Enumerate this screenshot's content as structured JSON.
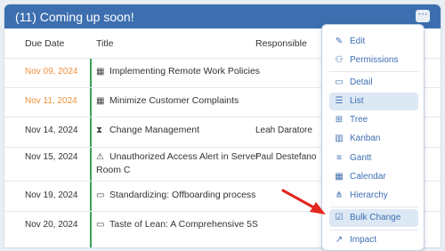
{
  "header": {
    "title": "(11) Coming up soon!",
    "menu_glyph": "⋯"
  },
  "columns": {
    "due": "Due Date",
    "title": "Title",
    "responsible": "Responsible"
  },
  "rows": [
    {
      "due": "Nov 09, 2024",
      "title": "Implementing Remote Work Policies",
      "responsible": "",
      "icon": "calendar-icon",
      "glyph": "▦",
      "overdue": true
    },
    {
      "due": "Nov 11, 2024",
      "title": "Minimize Customer Complaints",
      "responsible": "",
      "icon": "calendar-icon",
      "glyph": "▦",
      "overdue": true
    },
    {
      "due": "Nov 14, 2024",
      "title": "Change Management",
      "responsible": "Leah Daratore",
      "icon": "hourglass-icon",
      "glyph": "⧗",
      "overdue": false
    },
    {
      "due": "Nov 15, 2024",
      "title": "Unauthorized Access Alert in Server Room C",
      "responsible": "Paul Destefano",
      "icon": "warning-icon",
      "glyph": "⚠",
      "overdue": false
    },
    {
      "due": "Nov 19, 2024",
      "title": "Standardizing: Offboarding process",
      "responsible": "",
      "icon": "folder-icon",
      "glyph": "▭",
      "overdue": false
    },
    {
      "due": "Nov 20, 2024",
      "title": "Taste of Lean: A Comprehensive 5S",
      "responsible": "",
      "icon": "folder-icon",
      "glyph": "▭",
      "overdue": false
    }
  ],
  "menu": {
    "edit": {
      "label": "Edit",
      "glyph": "✎"
    },
    "permissions": {
      "label": "Permissions",
      "glyph": "⚇"
    },
    "detail": {
      "label": "Detail",
      "glyph": "▭"
    },
    "list": {
      "label": "List",
      "glyph": "☰"
    },
    "tree": {
      "label": "Tree",
      "glyph": "⊞"
    },
    "kanban": {
      "label": "Kanban",
      "glyph": "▥"
    },
    "gantt": {
      "label": "Gantt",
      "glyph": "≡"
    },
    "calendar": {
      "label": "Calendar",
      "glyph": "▦"
    },
    "hierarchy": {
      "label": "Hierarchy",
      "glyph": "⋔"
    },
    "bulk_change": {
      "label": "Bulk Change",
      "glyph": "☑"
    },
    "impact": {
      "label": "Impact",
      "glyph": "↗"
    }
  },
  "colors": {
    "header_bg": "#3d6fb0",
    "overdue": "#f0913c",
    "status_bar": "#3aa052",
    "menu_text": "#3d6fb0",
    "arrow": "#e0281e"
  }
}
